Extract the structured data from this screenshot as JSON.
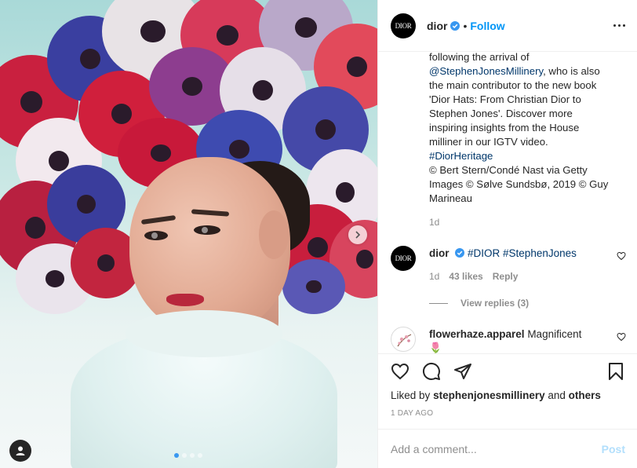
{
  "post": {
    "account": {
      "username": "dior",
      "avatar_text": "DIOR",
      "verified": true,
      "separator": "•",
      "follow_label": "Follow"
    },
    "caption": {
      "lines": [
        "following the arrival of",
        "@StephenJonesMillinery",
        ", who is also",
        "the main contributor to the new book",
        "'Dior Hats: From Christian Dior to",
        "Stephen Jones'. Discover more",
        "inspiring insights from the House",
        "milliner in our IGTV video.",
        "#DiorHeritage",
        "© Bert Stern/Condé Nast via Getty",
        "Images © Sølve Sundsbø, 2019 © Guy",
        "Marineau"
      ],
      "age": "1d"
    },
    "comments": [
      {
        "username": "dior",
        "avatar_text": "DIOR",
        "verified": true,
        "text": "#DIOR #StephenJones",
        "age": "1d",
        "likes": "43 likes",
        "reply_label": "Reply",
        "view_replies": "View replies (3)"
      },
      {
        "username": "flowerhaze.apparel",
        "text": "Magnificent",
        "emoji": "🌷"
      }
    ],
    "liked_by": {
      "prefix": "Liked by",
      "user": "stephenjonesmillinery",
      "and": "and",
      "others": "others"
    },
    "timestamp": "1 DAY AGO",
    "add_comment": {
      "placeholder": "Add a comment...",
      "post_label": "Post"
    },
    "carousel": {
      "total": 4,
      "active": 1
    }
  },
  "colors": {
    "accent": "#0095f6",
    "link": "#00376b",
    "muted": "#8e8e8e",
    "post_disabled": "#b2dffc"
  }
}
